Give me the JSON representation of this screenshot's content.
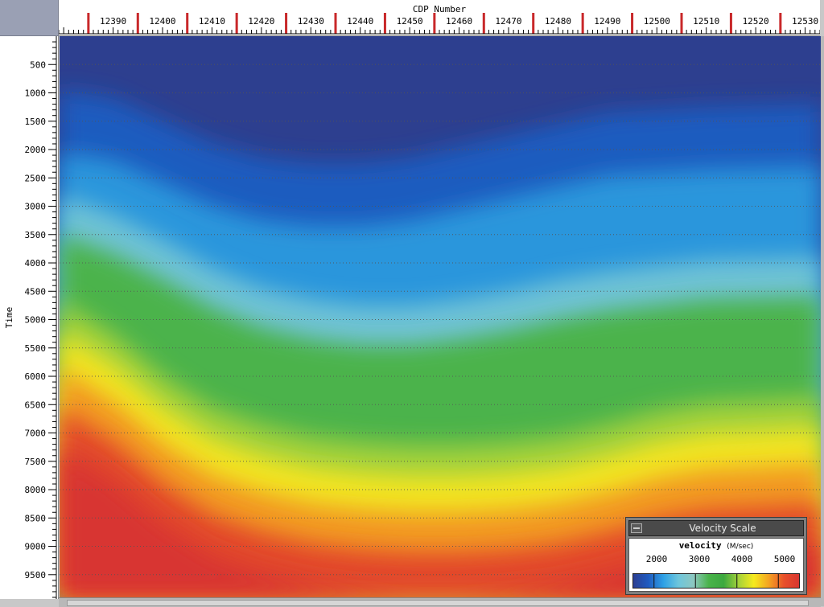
{
  "chart_data": {
    "type": "heatmap",
    "title": "",
    "xlabel": "CDP Number",
    "ylabel": "Time",
    "xlim": [
      12384,
      12538
    ],
    "ylim": [
      0,
      9900
    ],
    "x_major_ticks": [
      12390,
      12400,
      12410,
      12420,
      12430,
      12440,
      12450,
      12460,
      12470,
      12480,
      12490,
      12500,
      12510,
      12520,
      12530
    ],
    "y_major_ticks": [
      500,
      1000,
      1500,
      2000,
      2500,
      3000,
      3500,
      4000,
      4500,
      5000,
      5500,
      6000,
      6500,
      7000,
      7500,
      8000,
      8500,
      9000,
      9500
    ],
    "grid": "horizontal dotted",
    "colorbar": {
      "label": "velocity",
      "unit": "(M/sec)",
      "ticks": [
        2000,
        3000,
        4000,
        5000
      ],
      "range": [
        1500,
        5500
      ],
      "colors": [
        "#2b3f93",
        "#1f5bc0",
        "#2ea1e6",
        "#6ec6dc",
        "#8dc7c0",
        "#49b34a",
        "#3ca83f",
        "#a6d23a",
        "#f5ea1e",
        "#f4a322",
        "#e8502a",
        "#d83530"
      ],
      "ramp_dividers": [
        2000,
        3000,
        4000,
        5000
      ]
    },
    "contours": [
      {
        "velocity": 2500,
        "times": [
          2050,
          2200,
          2600,
          3000,
          3250,
          3350,
          3350,
          3250,
          3050,
          2850,
          2650,
          2450,
          2400,
          2350,
          2300
        ]
      },
      {
        "velocity": 3500,
        "times": [
          3500,
          3850,
          4300,
          4800,
          5150,
          5350,
          5450,
          5450,
          5350,
          5200,
          5000,
          4850,
          4750,
          4650,
          4600
        ]
      },
      {
        "velocity": 4100,
        "times": [
          5650,
          6250,
          7000,
          7550,
          7850,
          8050,
          8150,
          8200,
          8200,
          8150,
          8050,
          7850,
          7600,
          7450,
          7350
        ]
      }
    ],
    "contour_x": [
      12384,
      12395,
      12405,
      12415,
      12425,
      12435,
      12445,
      12455,
      12465,
      12475,
      12485,
      12495,
      12505,
      12515,
      12538
    ]
  },
  "legend": {
    "title": "Velocity Scale",
    "label": "velocity",
    "unit": "(M/sec)",
    "ticks": [
      "2000",
      "3000",
      "4000",
      "5000"
    ]
  },
  "colors": {
    "tick_marker": "#c8282a",
    "grid_line": "#555555"
  }
}
